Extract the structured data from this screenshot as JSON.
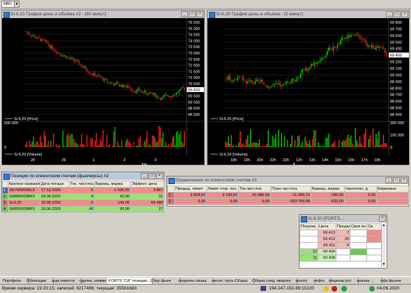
{
  "toolbar": {
    "combo_value": "M60"
  },
  "chart1": {
    "title": "Si-6.20 График цены и объёма #2 - [60 минут]",
    "y_labels": [
      "75 500",
      "75 000",
      "74 500",
      "74 000",
      "73 500",
      "73 000",
      "72 500",
      "72 000",
      "71 500",
      "71 000",
      "70 500",
      "70 000",
      "69 500",
      "69 000",
      "68 500",
      "68 000"
    ],
    "current_price": "69 403",
    "price_legend": "Si-6.20 [Price]",
    "volume_legend": "Si-6.20 [Volume]",
    "vol_labels": [
      "500 000",
      "0"
    ],
    "x_labels": [
      "28",
      "29",
      "1",
      "2",
      "3"
    ],
    "x_month": "Jun"
  },
  "chart2": {
    "title": "Si-6.20 График цены и объёма - [5 минут]",
    "y_labels": [
      "69 800",
      "69 700",
      "69 600",
      "69 500",
      "69 400",
      "69 300",
      "69 200",
      "69 100",
      "69 000",
      "68 900",
      "68 800",
      "68 700",
      "68 600",
      "68 500",
      "68 400"
    ],
    "current_price": "69 403",
    "price_legend": "Si-6.20 [Price]",
    "volume_legend": "Si-6.20 [Volume]",
    "vol_labels": [
      "200 000",
      "100 000",
      "0"
    ],
    "x_labels": [
      "18h",
      "19h",
      "20h",
      "22h",
      "23h",
      "12h",
      "13h",
      "14h",
      "15h",
      "16h",
      "17h",
      "18h"
    ],
    "x_day": "4"
  },
  "positions": {
    "title": "Позиции по клиентским счетам (фьючерсы) #2",
    "headers": [
      "Краткое название",
      "Дата погаше",
      "Тек. чист.поз.",
      "Вариац. маржа",
      "Эффект. цена"
    ],
    "rows": [
      {
        "idx": "1",
        "name": "Si0700000BL0",
        "date": "17.12.2020",
        "pos": "6",
        "margin": "-1 026,00",
        "price": "3 867"
      },
      {
        "idx": "2",
        "name": "Si0800000BF0",
        "date": "18.06.2020",
        "pos": "8",
        "margin": "16,00",
        "price": "31"
      },
      {
        "idx": "3",
        "name": "Si-6.20",
        "date": "18.06.2020",
        "pos": "-2",
        "margin": "140,00",
        "price": "69 489"
      },
      {
        "idx": "4",
        "name": "Si0830000BF0",
        "date": "18.06.2020",
        "pos": "45",
        "margin": "90,00",
        "price": "27"
      }
    ]
  },
  "limits": {
    "title": "Ограничения по клиентским счетам #2",
    "headers": [
      "Предыд. лимит",
      "Лимит откр. поз.",
      "Тек.чист.поз.",
      "План.чист.поз.",
      "Вариац. маржа",
      "Накоплен. д.",
      "Биржевые"
    ],
    "rows": [
      {
        "idx": "1",
        "c1": "9 829,87",
        "c2": "9 196,87",
        "c3": "20 486,59",
        "c4": "-11 289,72",
        "c5": "-780,00",
        "c6": "0,00",
        "c7": ""
      },
      {
        "idx": "2",
        "c1": "0,00",
        "c2": "0,00",
        "c3": "0,00",
        "c4": "-933 789,08",
        "c5": "-633,00",
        "c6": "0,00",
        "c7": ""
      }
    ]
  },
  "orderbook": {
    "title": "Si-6.20 [FORTS...",
    "headers": [
      "Покупка",
      "Цена",
      "Продажа",
      "Своя по",
      "Св"
    ],
    "rows": [
      {
        "buy": "",
        "price": "69 413",
        "sell": "7",
        "side": "sell"
      },
      {
        "buy": "",
        "price": "69 412",
        "sell": "25",
        "side": "sell"
      },
      {
        "buy": "",
        "price": "69 411",
        "sell": "4",
        "side": "sell"
      },
      {
        "buy": "12",
        "price": "69 409",
        "sell": "",
        "side": "buy"
      },
      {
        "buy": "11",
        "price": "69 408",
        "sell": "",
        "side": "buy"
      }
    ]
  },
  "tabs": [
    "Портфель",
    "Облигации",
    "экдк новости",
    "сделки, заявки",
    "FORTS \"СИ\" позиции...",
    "Сбер фьюч",
    "опционы сишка",
    "месяч. путы СИшка",
    "СИшка след. квартал",
    "золото",
    "нефть",
    "опционы ртс",
    "анализ ...",
    "офз фьючи"
  ],
  "status": {
    "server_time": "Время сервера: 19:20:15; записей: 9217496; текущая: 35591683",
    "ip": "194.247.150.89:15100",
    "date": "04.06.2020"
  },
  "colors": {
    "candle_up": "#00c800",
    "candle_down": "#e02020",
    "volume_up": "#00c000",
    "volume_down": "#ff2020"
  }
}
